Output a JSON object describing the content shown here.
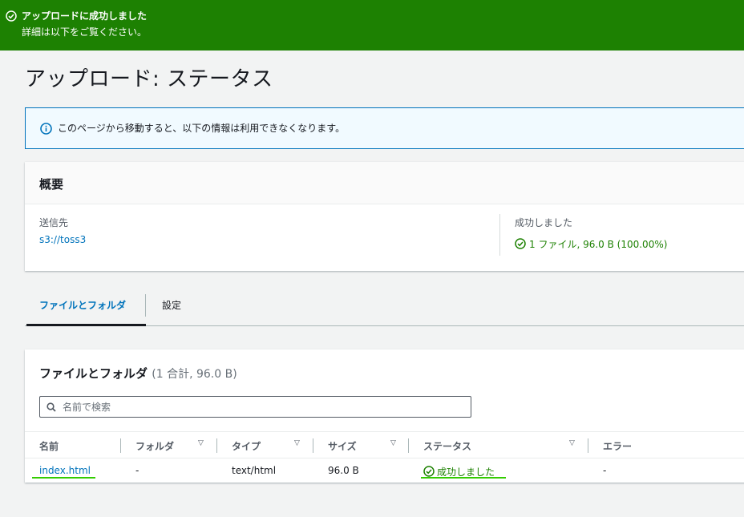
{
  "flash": {
    "title": "アップロードに成功しました",
    "subtitle": "詳細は以下をご覧ください。",
    "color": "#1d8102"
  },
  "page": {
    "title": "アップロード: ステータス"
  },
  "info_alert": {
    "text": "このページから移動すると、以下の情報は利用できなくなります。",
    "icon": "info-icon"
  },
  "summary": {
    "heading": "概要",
    "destination_label": "送信先",
    "destination_value": "s3://toss3",
    "status_label": "成功しました",
    "status_value": "1 ファイル, 96.0 B (100.00%)"
  },
  "tabs": [
    {
      "label": "ファイルとフォルダ",
      "active": true
    },
    {
      "label": "設定",
      "active": false
    }
  ],
  "files_panel": {
    "heading": "ファイルとフォルダ",
    "count": "(1 合計, 96.0 B)",
    "search_placeholder": "名前で検索",
    "columns": [
      "名前",
      "フォルダ",
      "タイプ",
      "サイズ",
      "ステータス",
      "エラー"
    ],
    "rows": [
      {
        "name": "index.html",
        "folder": "-",
        "type": "text/html",
        "size": "96.0 B",
        "status": "成功しました",
        "error": "-"
      }
    ]
  },
  "colors": {
    "link": "#0073bb",
    "success": "#1d8102",
    "highlight_underline": "#33cc00"
  }
}
